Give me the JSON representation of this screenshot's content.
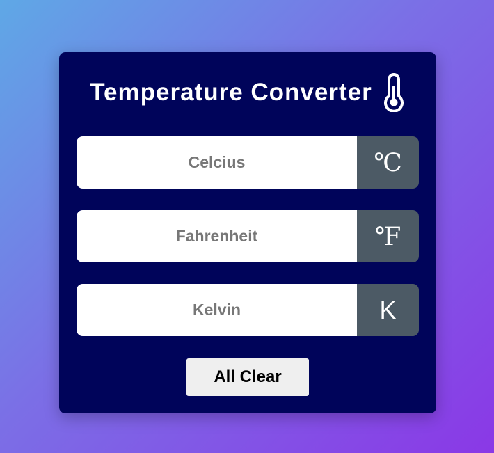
{
  "header": {
    "title": "Temperature Converter",
    "icon": "thermometer-icon"
  },
  "fields": [
    {
      "placeholder": "Celcius",
      "value": "",
      "unit": "℃"
    },
    {
      "placeholder": "Fahrenheit",
      "value": "",
      "unit": "℉"
    },
    {
      "placeholder": "Kelvin",
      "value": "",
      "unit": "K"
    }
  ],
  "actions": {
    "clear_label": "All Clear"
  },
  "colors": {
    "card_background": "#00045a",
    "unit_background": "#4c5a65",
    "button_background": "#efefef",
    "gradient_start": "#5fa8e6",
    "gradient_end": "#8a38e6"
  }
}
